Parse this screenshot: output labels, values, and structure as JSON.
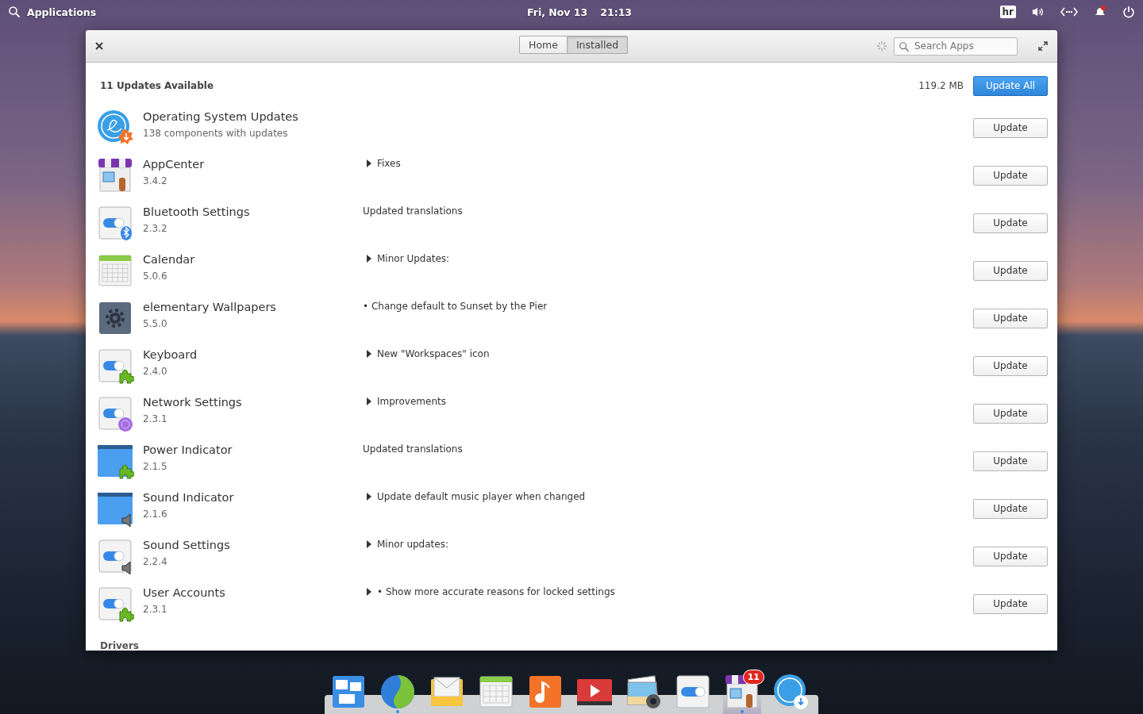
{
  "panel": {
    "applications": "Applications",
    "date": "Fri, Nov 13",
    "time": "21:13",
    "keyboard_layout": "hr"
  },
  "window": {
    "tabs": [
      {
        "label": "Home",
        "selected": false
      },
      {
        "label": "Installed",
        "selected": true
      }
    ],
    "search": {
      "placeholder": "Search Apps"
    },
    "summary": "11 Updates Available",
    "size": "119.2 MB",
    "update_all": "Update All",
    "rows": [
      {
        "name": "Operating System Updates",
        "detail": "138 components with updates",
        "expander": false,
        "button": "Update"
      },
      {
        "name": "AppCenter",
        "detail": "3.4.2",
        "expander": true,
        "notes": "Fixes",
        "button": "Update"
      },
      {
        "name": "Bluetooth Settings",
        "detail": "2.3.2",
        "expander": false,
        "notes": "Updated translations",
        "button": "Update"
      },
      {
        "name": "Calendar",
        "detail": "5.0.6",
        "expander": true,
        "notes": "Minor Updates:",
        "button": "Update"
      },
      {
        "name": "elementary Wallpapers",
        "detail": "5.5.0",
        "expander": false,
        "notes": "• Change default to Sunset by the Pier",
        "button": "Update"
      },
      {
        "name": "Keyboard",
        "detail": "2.4.0",
        "expander": true,
        "notes": "New \"Workspaces\" icon",
        "button": "Update"
      },
      {
        "name": "Network Settings",
        "detail": "2.3.1",
        "expander": true,
        "notes": "Improvements",
        "button": "Update"
      },
      {
        "name": "Power Indicator",
        "detail": "2.1.5",
        "expander": false,
        "notes": "Updated translations",
        "button": "Update"
      },
      {
        "name": "Sound Indicator",
        "detail": "2.1.6",
        "expander": true,
        "notes": "Update default music player when changed",
        "button": "Update"
      },
      {
        "name": "Sound Settings",
        "detail": "2.2.4",
        "expander": true,
        "notes": "Minor updates:",
        "button": "Update"
      },
      {
        "name": "User Accounts",
        "detail": "2.3.1",
        "expander": true,
        "notes": "• Show more accurate reasons for locked settings",
        "button": "Update"
      }
    ],
    "section": "Drivers"
  },
  "dock": [
    {
      "kind": "multitasking",
      "running": false,
      "selected": false
    },
    {
      "kind": "browser",
      "running": true,
      "selected": false
    },
    {
      "kind": "mail",
      "running": false,
      "selected": false
    },
    {
      "kind": "calendar",
      "running": false,
      "selected": false
    },
    {
      "kind": "music",
      "running": false,
      "selected": false
    },
    {
      "kind": "videos",
      "running": false,
      "selected": false
    },
    {
      "kind": "photos",
      "running": false,
      "selected": false
    },
    {
      "kind": "settings",
      "running": false,
      "selected": false
    },
    {
      "kind": "store",
      "running": true,
      "selected": true,
      "badge": "11"
    },
    {
      "kind": "os",
      "running": false,
      "selected": false
    }
  ]
}
